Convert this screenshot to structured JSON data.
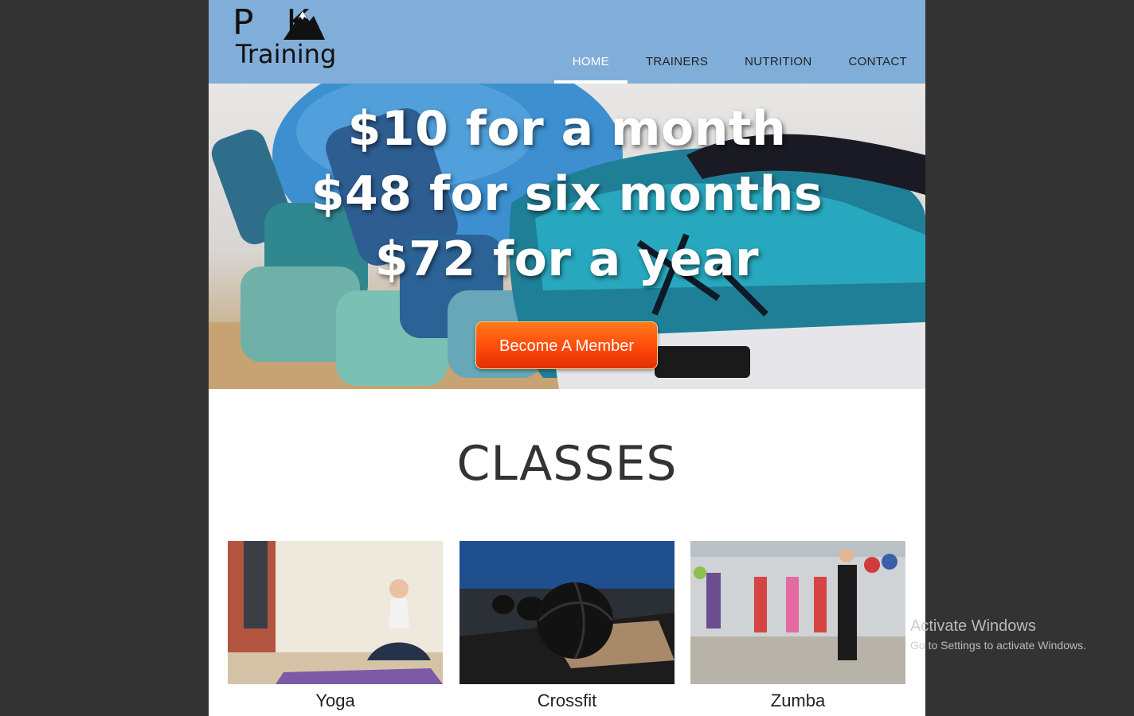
{
  "brand": {
    "logo_line1": "PEAK",
    "logo_line2": "Training"
  },
  "nav": {
    "items": [
      {
        "label": "HOME",
        "active": true
      },
      {
        "label": "TRAINERS",
        "active": false
      },
      {
        "label": "NUTRITION",
        "active": false
      },
      {
        "label": "CONTACT",
        "active": false
      }
    ]
  },
  "hero": {
    "prices": [
      "$10 for a month",
      "$48 for six months",
      "$72 for a year"
    ],
    "cta_label": "Become A Member"
  },
  "classes": {
    "title": "CLASSES",
    "items": [
      {
        "label": "Yoga"
      },
      {
        "label": "Crossfit"
      },
      {
        "label": "Zumba"
      }
    ]
  },
  "watermark": {
    "title": "Activate Windows",
    "subtitle": "Go to Settings to activate Windows."
  },
  "colors": {
    "header_bg": "#81aed9",
    "outer_bg": "#333333",
    "cta_gradient_top": "#ff7a1c",
    "cta_gradient_bottom": "#e23000"
  }
}
